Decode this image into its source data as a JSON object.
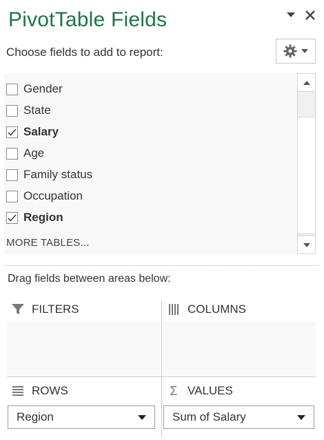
{
  "header": {
    "title": "PivotTable Fields"
  },
  "fields_section": {
    "label": "Choose fields to add to report:"
  },
  "fields": [
    {
      "label": "Gender",
      "checked": false
    },
    {
      "label": "State",
      "checked": false
    },
    {
      "label": "Salary",
      "checked": true
    },
    {
      "label": "Age",
      "checked": false
    },
    {
      "label": "Family status",
      "checked": false
    },
    {
      "label": "Occupation",
      "checked": false
    },
    {
      "label": "Region",
      "checked": true
    }
  ],
  "more_tables": "MORE TABLES...",
  "areas": {
    "label": "Drag fields between areas below:",
    "filters": {
      "label": "FILTERS"
    },
    "columns": {
      "label": "COLUMNS"
    },
    "rows": {
      "label": "ROWS",
      "item": "Region"
    },
    "values": {
      "label": "VALUES",
      "item": "Sum of Salary"
    }
  },
  "colors": {
    "title": "#217346"
  }
}
